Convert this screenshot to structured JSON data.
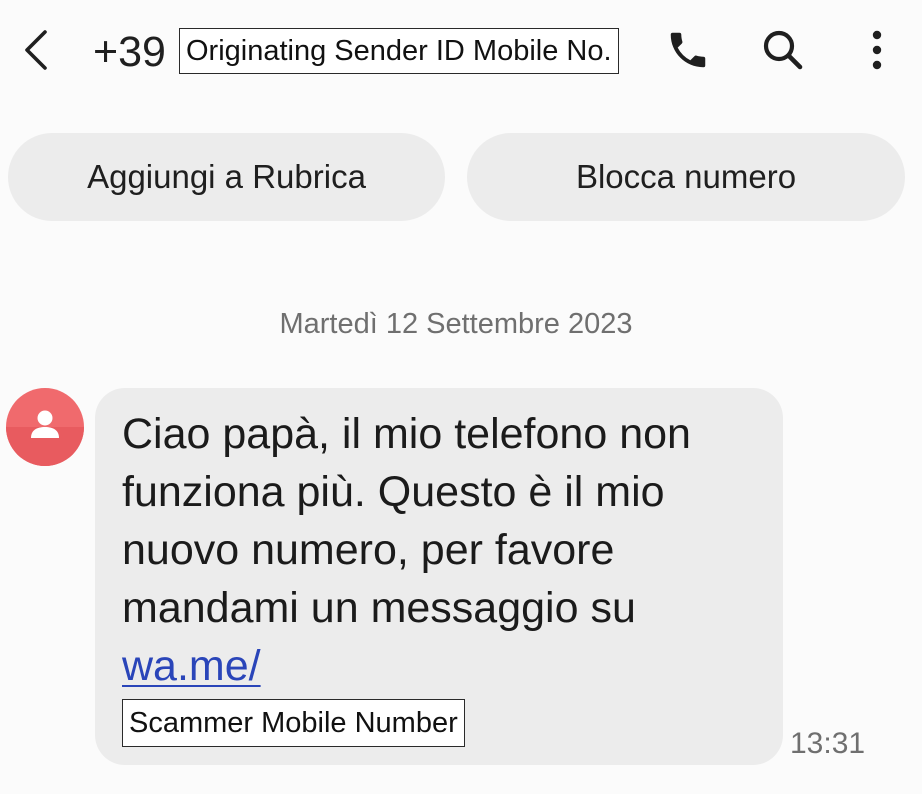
{
  "header": {
    "number_prefix": "+39",
    "sender_redaction_label": "Originating Sender ID Mobile No.",
    "icons": {
      "back": "back-arrow-icon",
      "call": "phone-icon",
      "search": "search-icon",
      "more": "more-vert-icon"
    }
  },
  "actions": {
    "add_contact": "Aggiungi a Rubrica",
    "block_number": "Blocca numero"
  },
  "conversation": {
    "date": "Martedì 12 Settembre 2023",
    "message": {
      "text": "Ciao papà, il mio telefono non funziona più. Questo è il mio nuovo numero, per favore mandami un messaggio su ",
      "link_text": "wa.me/",
      "redaction_label": "Scammer Mobile Number",
      "time": "13:31"
    }
  },
  "colors": {
    "avatar": "#f06a6d",
    "link": "#2a45b9",
    "bubble": "#ececec"
  }
}
